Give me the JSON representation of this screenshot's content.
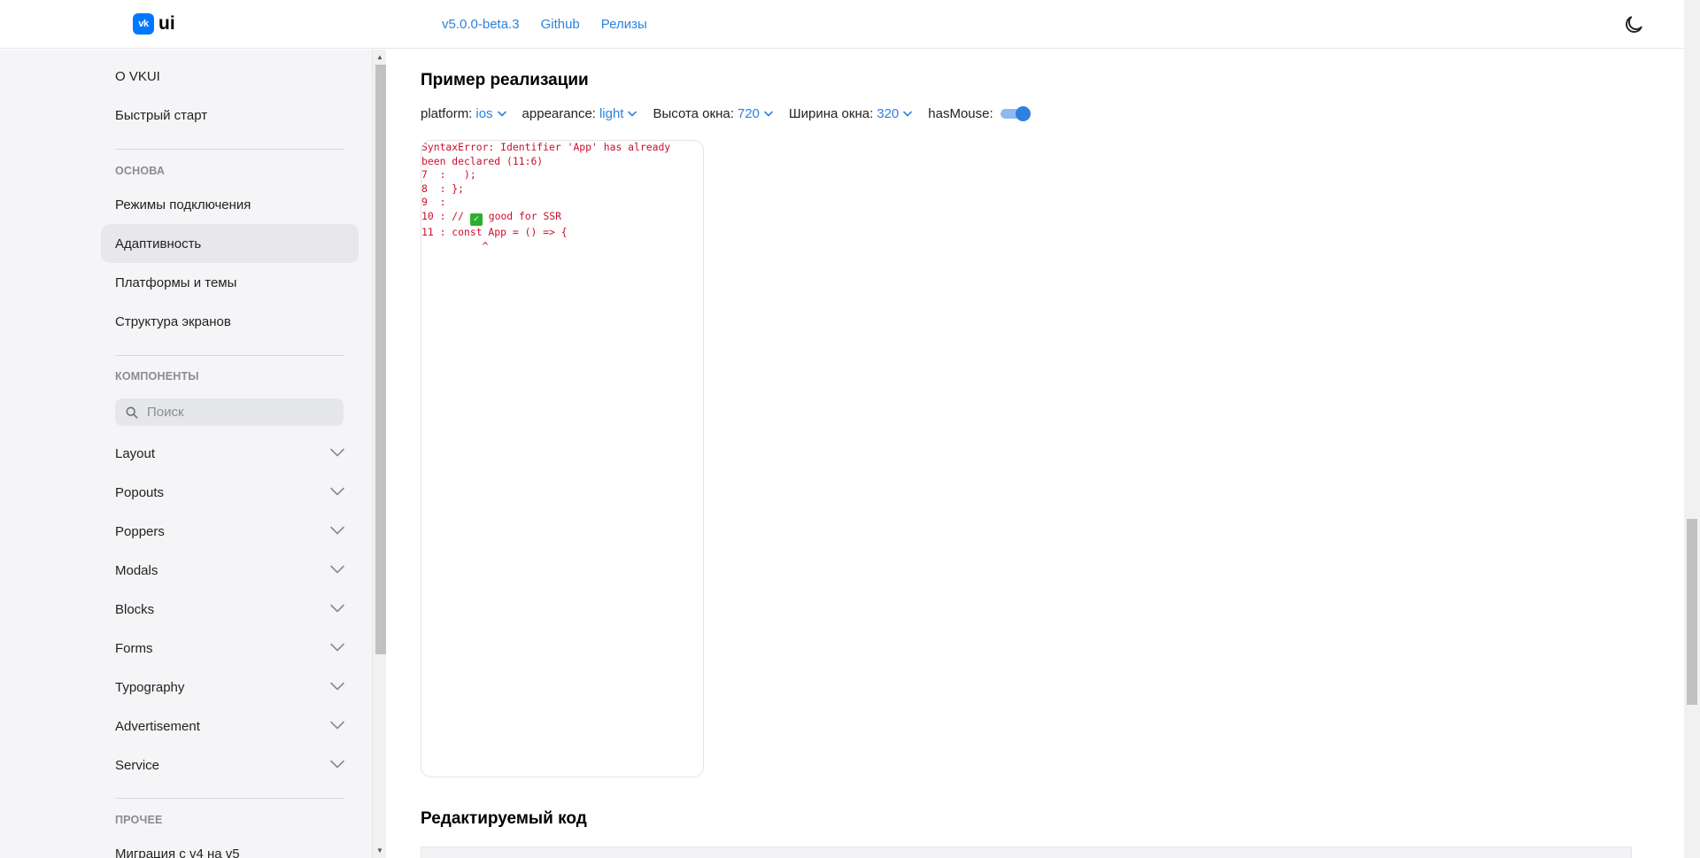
{
  "header": {
    "logo_text": "ui",
    "logo_badge": "vk",
    "nav": [
      {
        "label": "v5.0.0-beta.3"
      },
      {
        "label": "Github"
      },
      {
        "label": "Релизы"
      }
    ],
    "theme_icon": "moon-icon"
  },
  "sidebar": {
    "top_items": [
      {
        "label": "О VKUI"
      },
      {
        "label": "Быстрый старт"
      }
    ],
    "sections": [
      {
        "title": "ОСНОВА"
      },
      {
        "title": "КОМПОНЕНТЫ"
      },
      {
        "title": "ПРОЧЕЕ"
      }
    ],
    "basics": [
      {
        "label": "Режимы подключения"
      },
      {
        "label": "Адаптивность",
        "active": true
      },
      {
        "label": "Платформы и темы"
      },
      {
        "label": "Структура экранов"
      }
    ],
    "search": {
      "placeholder": "Поиск",
      "value": ""
    },
    "components": [
      {
        "label": "Layout"
      },
      {
        "label": "Popouts"
      },
      {
        "label": "Poppers"
      },
      {
        "label": "Modals"
      },
      {
        "label": "Blocks"
      },
      {
        "label": "Forms"
      },
      {
        "label": "Typography"
      },
      {
        "label": "Advertisement"
      },
      {
        "label": "Service"
      }
    ],
    "other": [
      {
        "label": "Миграция с v4 на v5"
      }
    ]
  },
  "main": {
    "example_title": "Пример реализации",
    "controls": {
      "platform_label": "platform:",
      "platform_value": "ios",
      "appearance_label": "appearance:",
      "appearance_value": "light",
      "height_label": "Высота окна:",
      "height_value": "720",
      "width_label": "Ширина окна:",
      "width_value": "320",
      "hasmouse_label": "hasMouse:",
      "hasmouse_on": true
    },
    "error_lines": [
      "SyntaxError: Identifier 'App' has already",
      "been declared (11:6)",
      "7  :   );",
      "8  : };",
      "9  :",
      "10 : // ",
      "11 : const App = () => {",
      "          ^"
    ],
    "error_check_suffix": " good for SSR",
    "code_title": "Редактируемый код"
  },
  "colors": {
    "accent": "#2d81e0",
    "error": "#c8102e",
    "brand": "#0077ff"
  }
}
